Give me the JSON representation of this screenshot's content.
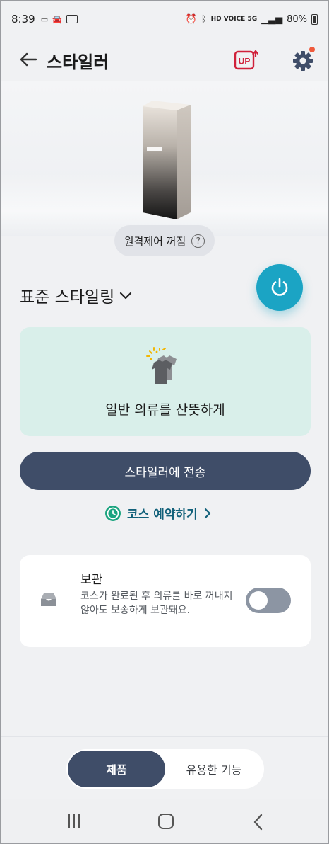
{
  "status_bar": {
    "time": "8:39",
    "network": "HD VOICE 5G",
    "battery": "80%"
  },
  "app_bar": {
    "title": "스타일러",
    "up_badge": "UP"
  },
  "device": {
    "remote_status": "원격제어 꺼짐",
    "help_symbol": "?"
  },
  "course": {
    "selected": "표준 스타일링",
    "description": "일반 의류를 산뜻하게"
  },
  "actions": {
    "send_label": "스타일러에 전송",
    "schedule_label": "코스 예약하기"
  },
  "storage": {
    "title": "보관",
    "description": "코스가 완료된 후 의류를 바로 꺼내지 않아도 보송하게 보관돼요.",
    "enabled": false
  },
  "bottom_tabs": {
    "items": [
      "제품",
      "유용한 기능"
    ],
    "active": "제품"
  },
  "colors": {
    "primary_navy": "#3f4d68",
    "accent_teal": "#1ba4c4",
    "card_mint": "#d9efea",
    "notify_dot": "#ef5a3c",
    "up_red": "#d0213a"
  }
}
